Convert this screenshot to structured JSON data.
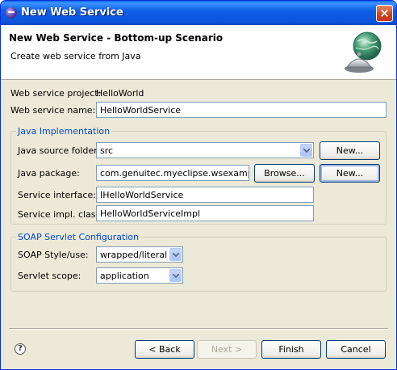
{
  "window": {
    "title": "New Web Service",
    "close_symbol": "×",
    "icon": "eclipse-icon"
  },
  "banner": {
    "title": "New Web Service - Bottom-up Scenario",
    "description": "Create web service from Java",
    "graphic": "web-service-globe-icon"
  },
  "project": {
    "label": "Web service project:",
    "value": "HelloWorld"
  },
  "service_name": {
    "label": "Web service name:",
    "value": "HelloWorldService"
  },
  "java_impl": {
    "title": "Java Implementation",
    "source_folder_label": "Java source folder:",
    "source_folder_value": "src",
    "source_new_label": "New...",
    "package_label": "Java package:",
    "package_value": "com.genuitec.myeclipse.wsexample",
    "browse_label": "Browse...",
    "package_new_label": "New...",
    "interface_label": "Service interface:",
    "interface_value": "IHelloWorldService",
    "impl_label": "Service impl. class:",
    "impl_value": "HelloWorldServiceImpl"
  },
  "soap_config": {
    "title": "SOAP  Servlet Configuration",
    "style_label": "SOAP Style/use:",
    "style_value": "wrapped/literal",
    "scope_label": "Servlet scope:",
    "scope_value": "application"
  },
  "footer": {
    "help_symbol": "?",
    "back_label": "< Back",
    "next_label": "Next >",
    "finish_label": "Finish",
    "cancel_label": "Cancel"
  },
  "colors": {
    "titlebar": "#0a55dc",
    "dialog_bg": "#ece9d8",
    "group_title": "#0046d5",
    "field_border": "#7f9db9"
  }
}
